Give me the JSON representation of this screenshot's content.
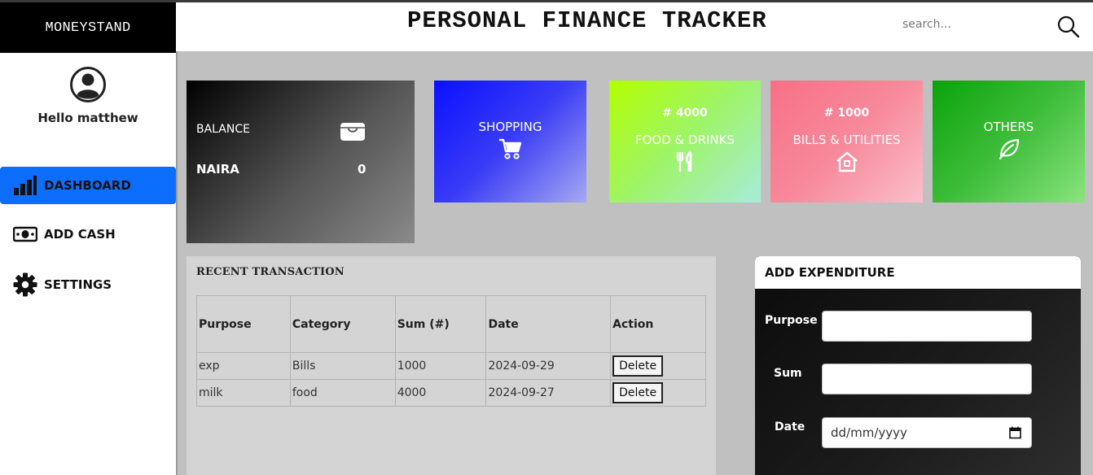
{
  "brand": "MONEYSTAND",
  "header": {
    "title": "PERSONAL FINANCE TRACKER",
    "search_placeholder": "search..."
  },
  "sidebar": {
    "greeting": "Hello matthew",
    "items": [
      {
        "label": "DASHBOARD",
        "icon": "bar-chart-icon",
        "active": true
      },
      {
        "label": "ADD CASH",
        "icon": "cash-icon"
      },
      {
        "label": "SETTINGS",
        "icon": "gear-icon"
      }
    ]
  },
  "balance": {
    "label": "BALANCE",
    "currency": "NAIRA",
    "value": "0",
    "icon": "wallet-icon"
  },
  "categories": [
    {
      "name": "SHOPPING",
      "amount": "",
      "icon": "cart-icon"
    },
    {
      "name": "FOOD & DRINKS",
      "amount": "# 4000",
      "icon": "cutlery-icon"
    },
    {
      "name": "BILLS & UTILITIES",
      "amount": "# 1000",
      "icon": "house-icon"
    },
    {
      "name": "OTHERS",
      "amount": "",
      "icon": "leaf-icon"
    }
  ],
  "recent": {
    "title": "RECENT TRANSACTION",
    "columns": [
      "Purpose",
      "Category",
      "Sum (#)",
      "Date",
      "Action"
    ],
    "rows": [
      {
        "purpose": "exp",
        "category": "Bills",
        "sum": "1000",
        "date": "2024-09-29",
        "action": "Delete"
      },
      {
        "purpose": "milk",
        "category": "food",
        "sum": "4000",
        "date": "2024-09-27",
        "action": "Delete"
      }
    ]
  },
  "form": {
    "title": "ADD EXPENDITURE",
    "purpose_label": "Purpose",
    "purpose_value": "",
    "sum_label": "Sum",
    "sum_value": "",
    "date_label": "Date",
    "date_placeholder": "dd/mm/yyyy"
  },
  "colors": {
    "accent": "#0d6efd",
    "shopping": "#0a10ff",
    "food": "#b2ff00",
    "bills": "#f77086",
    "others": "#0aa30a"
  }
}
